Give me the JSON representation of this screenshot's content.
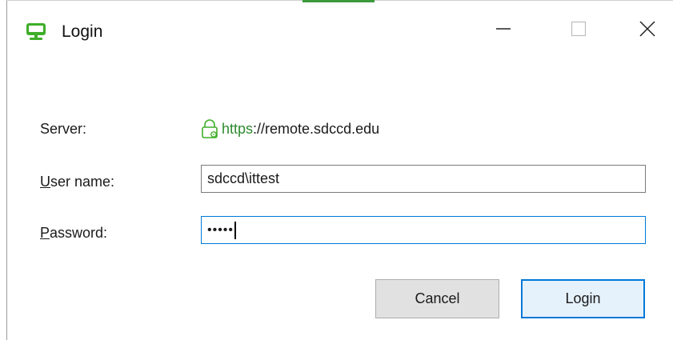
{
  "window": {
    "title": "Login",
    "icon": "remote-desktop-icon",
    "controls": {
      "minimize": "minimize-icon",
      "maximize": "maximize-icon",
      "close": "close-icon"
    }
  },
  "form": {
    "server": {
      "label": "Server:",
      "scheme": "https",
      "rest": "://remote.sdccd.edu",
      "icon": "lock-icon"
    },
    "username": {
      "label_access_key": "U",
      "label_rest": "ser name:",
      "value": "sdccd\\ittest"
    },
    "password": {
      "label_access_key": "P",
      "label_rest": "assword:",
      "masked": "•••••"
    }
  },
  "buttons": {
    "cancel": "Cancel",
    "login": "Login"
  },
  "colors": {
    "accent": "#0078d7",
    "secure": "#2e8b2e",
    "icon_green": "#3fae29"
  }
}
